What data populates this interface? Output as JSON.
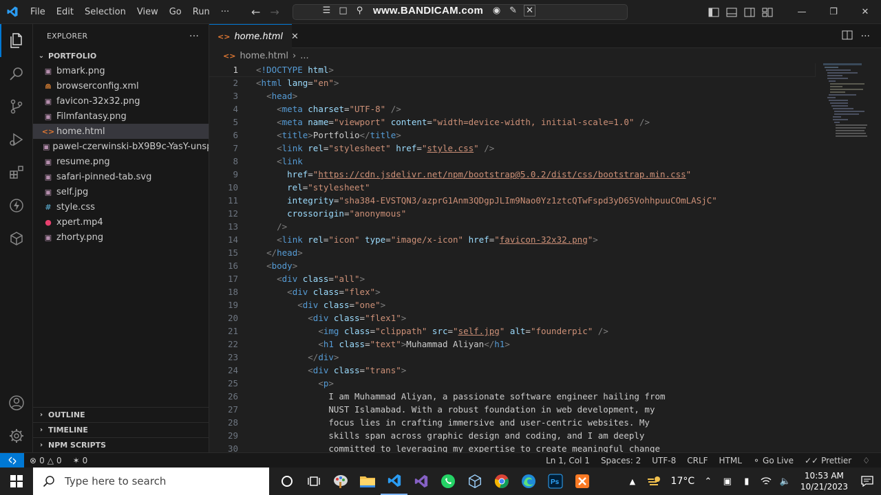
{
  "menu": [
    "File",
    "Edit",
    "Selection",
    "View",
    "Go",
    "Run",
    "···"
  ],
  "overlay": {
    "bandicam": "www.BANDICAM.com"
  },
  "explorer": {
    "title": "EXPLORER",
    "more": "···",
    "folder": "PORTFOLIO",
    "files": [
      {
        "name": "bmark.png",
        "icon": "image-file-icon",
        "color": "#b48ead"
      },
      {
        "name": "browserconfig.xml",
        "icon": "rss-file-icon",
        "color": "#f08c36"
      },
      {
        "name": "favicon-32x32.png",
        "icon": "image-file-icon",
        "color": "#b48ead"
      },
      {
        "name": "Filmfantasy.png",
        "icon": "image-file-icon",
        "color": "#b48ead"
      },
      {
        "name": "home.html",
        "icon": "html-file-icon",
        "color": "#e37933"
      },
      {
        "name": "pawel-czerwinski-bX9B9c-YasY-unsp...",
        "icon": "image-file-icon",
        "color": "#b48ead"
      },
      {
        "name": "resume.png",
        "icon": "image-file-icon",
        "color": "#b48ead"
      },
      {
        "name": "safari-pinned-tab.svg",
        "icon": "image-file-icon",
        "color": "#b48ead"
      },
      {
        "name": "self.jpg",
        "icon": "image-file-icon",
        "color": "#b48ead"
      },
      {
        "name": "style.css",
        "icon": "css-file-icon",
        "color": "#519aba"
      },
      {
        "name": "xpert.mp4",
        "icon": "video-file-icon",
        "color": "#e8406e"
      },
      {
        "name": "zhorty.png",
        "icon": "image-file-icon",
        "color": "#b48ead"
      }
    ],
    "sections": [
      "OUTLINE",
      "TIMELINE",
      "NPM SCRIPTS"
    ]
  },
  "editor": {
    "tab": "home.html",
    "breadcrumb_file": "home.html",
    "breadcrumb_more": "...",
    "lines": [
      [
        [
          "br",
          "<"
        ],
        [
          "kw",
          "!DOCTYPE"
        ],
        [
          "txt",
          " "
        ],
        [
          "attr",
          "html"
        ],
        [
          "br",
          ">"
        ]
      ],
      [
        [
          "br",
          "<"
        ],
        [
          "tag",
          "html"
        ],
        [
          "txt",
          " "
        ],
        [
          "attr",
          "lang"
        ],
        [
          "eq",
          "="
        ],
        [
          "str",
          "\"en\""
        ],
        [
          "br",
          ">"
        ]
      ],
      [
        [
          "txt",
          "  "
        ],
        [
          "br",
          "<"
        ],
        [
          "tag",
          "head"
        ],
        [
          "br",
          ">"
        ]
      ],
      [
        [
          "txt",
          "    "
        ],
        [
          "br",
          "<"
        ],
        [
          "tag",
          "meta"
        ],
        [
          "txt",
          " "
        ],
        [
          "attr",
          "charset"
        ],
        [
          "eq",
          "="
        ],
        [
          "str",
          "\"UTF-8\""
        ],
        [
          "txt",
          " "
        ],
        [
          "br",
          "/>"
        ]
      ],
      [
        [
          "txt",
          "    "
        ],
        [
          "br",
          "<"
        ],
        [
          "tag",
          "meta"
        ],
        [
          "txt",
          " "
        ],
        [
          "attr",
          "name"
        ],
        [
          "eq",
          "="
        ],
        [
          "str",
          "\"viewport\""
        ],
        [
          "txt",
          " "
        ],
        [
          "attr",
          "content"
        ],
        [
          "eq",
          "="
        ],
        [
          "str",
          "\"width=device-width, initial-scale=1.0\""
        ],
        [
          "txt",
          " "
        ],
        [
          "br",
          "/>"
        ]
      ],
      [
        [
          "txt",
          "    "
        ],
        [
          "br",
          "<"
        ],
        [
          "tag",
          "title"
        ],
        [
          "br",
          ">"
        ],
        [
          "txt",
          "Portfolio"
        ],
        [
          "br",
          "</"
        ],
        [
          "tag",
          "title"
        ],
        [
          "br",
          ">"
        ]
      ],
      [
        [
          "txt",
          "    "
        ],
        [
          "br",
          "<"
        ],
        [
          "tag",
          "link"
        ],
        [
          "txt",
          " "
        ],
        [
          "attr",
          "rel"
        ],
        [
          "eq",
          "="
        ],
        [
          "str",
          "\"stylesheet\""
        ],
        [
          "txt",
          " "
        ],
        [
          "attr",
          "href"
        ],
        [
          "eq",
          "="
        ],
        [
          "str",
          "\""
        ],
        [
          "stru",
          "style.css"
        ],
        [
          "str",
          "\""
        ],
        [
          "txt",
          " "
        ],
        [
          "br",
          "/>"
        ]
      ],
      [
        [
          "txt",
          "    "
        ],
        [
          "br",
          "<"
        ],
        [
          "tag",
          "link"
        ]
      ],
      [
        [
          "txt",
          "      "
        ],
        [
          "attr",
          "href"
        ],
        [
          "eq",
          "="
        ],
        [
          "str",
          "\""
        ],
        [
          "stru",
          "https://cdn.jsdelivr.net/npm/bootstrap@5.0.2/dist/css/bootstrap.min.css"
        ],
        [
          "str",
          "\""
        ]
      ],
      [
        [
          "txt",
          "      "
        ],
        [
          "attr",
          "rel"
        ],
        [
          "eq",
          "="
        ],
        [
          "str",
          "\"stylesheet\""
        ]
      ],
      [
        [
          "txt",
          "      "
        ],
        [
          "attr",
          "integrity"
        ],
        [
          "eq",
          "="
        ],
        [
          "str",
          "\"sha384-EVSTQN3/azprG1Anm3QDgpJLIm9Nao0Yz1ztcQTwFspd3yD65VohhpuuCOmLASjC\""
        ]
      ],
      [
        [
          "txt",
          "      "
        ],
        [
          "attr",
          "crossorigin"
        ],
        [
          "eq",
          "="
        ],
        [
          "str",
          "\"anonymous\""
        ]
      ],
      [
        [
          "txt",
          "    "
        ],
        [
          "br",
          "/>"
        ]
      ],
      [
        [
          "txt",
          "    "
        ],
        [
          "br",
          "<"
        ],
        [
          "tag",
          "link"
        ],
        [
          "txt",
          " "
        ],
        [
          "attr",
          "rel"
        ],
        [
          "eq",
          "="
        ],
        [
          "str",
          "\"icon\""
        ],
        [
          "txt",
          " "
        ],
        [
          "attr",
          "type"
        ],
        [
          "eq",
          "="
        ],
        [
          "str",
          "\"image/x-icon\""
        ],
        [
          "txt",
          " "
        ],
        [
          "attr",
          "href"
        ],
        [
          "eq",
          "="
        ],
        [
          "str",
          "\""
        ],
        [
          "stru",
          "favicon-32x32.png"
        ],
        [
          "str",
          "\""
        ],
        [
          "br",
          ">"
        ]
      ],
      [
        [
          "txt",
          "  "
        ],
        [
          "br",
          "</"
        ],
        [
          "tag",
          "head"
        ],
        [
          "br",
          ">"
        ]
      ],
      [
        [
          "txt",
          "  "
        ],
        [
          "br",
          "<"
        ],
        [
          "tag",
          "body"
        ],
        [
          "br",
          ">"
        ]
      ],
      [
        [
          "txt",
          "    "
        ],
        [
          "br",
          "<"
        ],
        [
          "tag",
          "div"
        ],
        [
          "txt",
          " "
        ],
        [
          "attr",
          "class"
        ],
        [
          "eq",
          "="
        ],
        [
          "str",
          "\"all\""
        ],
        [
          "br",
          ">"
        ]
      ],
      [
        [
          "txt",
          "      "
        ],
        [
          "br",
          "<"
        ],
        [
          "tag",
          "div"
        ],
        [
          "txt",
          " "
        ],
        [
          "attr",
          "class"
        ],
        [
          "eq",
          "="
        ],
        [
          "str",
          "\"flex\""
        ],
        [
          "br",
          ">"
        ]
      ],
      [
        [
          "txt",
          "        "
        ],
        [
          "br",
          "<"
        ],
        [
          "tag",
          "div"
        ],
        [
          "txt",
          " "
        ],
        [
          "attr",
          "class"
        ],
        [
          "eq",
          "="
        ],
        [
          "str",
          "\"one\""
        ],
        [
          "br",
          ">"
        ]
      ],
      [
        [
          "txt",
          "          "
        ],
        [
          "br",
          "<"
        ],
        [
          "tag",
          "div"
        ],
        [
          "txt",
          " "
        ],
        [
          "attr",
          "class"
        ],
        [
          "eq",
          "="
        ],
        [
          "str",
          "\"flex1\""
        ],
        [
          "br",
          ">"
        ]
      ],
      [
        [
          "txt",
          "            "
        ],
        [
          "br",
          "<"
        ],
        [
          "tag",
          "img"
        ],
        [
          "txt",
          " "
        ],
        [
          "attr",
          "class"
        ],
        [
          "eq",
          "="
        ],
        [
          "str",
          "\"clippath\""
        ],
        [
          "txt",
          " "
        ],
        [
          "attr",
          "src"
        ],
        [
          "eq",
          "="
        ],
        [
          "str",
          "\""
        ],
        [
          "stru",
          "self.jpg"
        ],
        [
          "str",
          "\""
        ],
        [
          "txt",
          " "
        ],
        [
          "attr",
          "alt"
        ],
        [
          "eq",
          "="
        ],
        [
          "str",
          "\"founderpic\""
        ],
        [
          "txt",
          " "
        ],
        [
          "br",
          "/>"
        ]
      ],
      [
        [
          "txt",
          "            "
        ],
        [
          "br",
          "<"
        ],
        [
          "tag",
          "h1"
        ],
        [
          "txt",
          " "
        ],
        [
          "attr",
          "class"
        ],
        [
          "eq",
          "="
        ],
        [
          "str",
          "\"text\""
        ],
        [
          "br",
          ">"
        ],
        [
          "txt",
          "Muhammad Aliyan"
        ],
        [
          "br",
          "</"
        ],
        [
          "tag",
          "h1"
        ],
        [
          "br",
          ">"
        ]
      ],
      [
        [
          "txt",
          "          "
        ],
        [
          "br",
          "</"
        ],
        [
          "tag",
          "div"
        ],
        [
          "br",
          ">"
        ]
      ],
      [
        [
          "txt",
          "          "
        ],
        [
          "br",
          "<"
        ],
        [
          "tag",
          "div"
        ],
        [
          "txt",
          " "
        ],
        [
          "attr",
          "class"
        ],
        [
          "eq",
          "="
        ],
        [
          "str",
          "\"trans\""
        ],
        [
          "br",
          ">"
        ]
      ],
      [
        [
          "txt",
          "            "
        ],
        [
          "br",
          "<"
        ],
        [
          "tag",
          "p"
        ],
        [
          "br",
          ">"
        ]
      ],
      [
        [
          "txt",
          "              I am Muhammad Aliyan, a passionate software engineer hailing from"
        ]
      ],
      [
        [
          "txt",
          "              NUST Islamabad. With a robust foundation in web development, my"
        ]
      ],
      [
        [
          "txt",
          "              focus lies in crafting immersive and user-centric websites. My"
        ]
      ],
      [
        [
          "txt",
          "              skills span across graphic design and coding, and I am deeply"
        ]
      ],
      [
        [
          "txt",
          "              committed to leveraging my expertise to create meaningful change"
        ]
      ]
    ]
  },
  "status": {
    "errors": "0",
    "warnings": "0",
    "ports": "0",
    "position": "Ln 1, Col 1",
    "spaces": "Spaces: 2",
    "encoding": "UTF-8",
    "eol": "CRLF",
    "language": "HTML",
    "golive": "Go Live",
    "prettier": "Prettier"
  },
  "taskbar": {
    "search_placeholder": "Type here to search",
    "temperature": "17°C",
    "time": "10:53 AM",
    "date": "10/21/2023"
  },
  "colors": {
    "accent": "#0078d4",
    "sidebar_bg": "#181818",
    "editor_bg": "#1f1f1f"
  }
}
